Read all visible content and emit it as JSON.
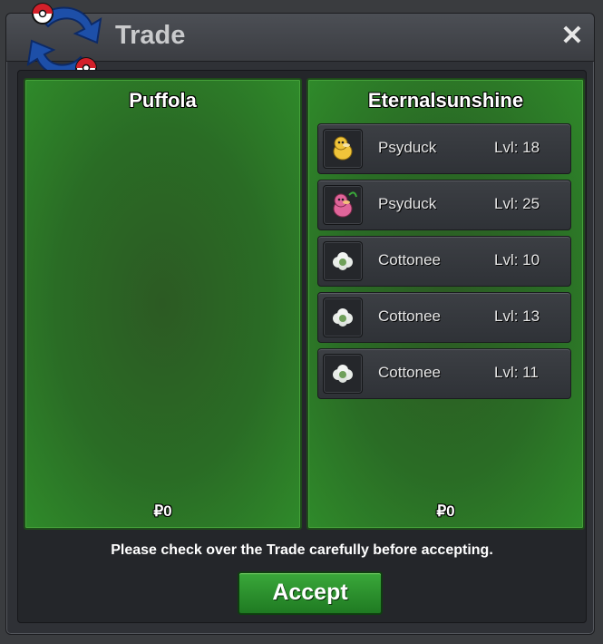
{
  "window": {
    "title": "Trade"
  },
  "left_panel": {
    "trainer": "Puffola",
    "money": "₽0"
  },
  "right_panel": {
    "trainer": "Eternalsunshine",
    "money": "₽0",
    "pokemon": [
      {
        "name": "Psyduck",
        "level": "Lvl: 18",
        "sprite_icon": "psyduck-icon"
      },
      {
        "name": "Psyduck",
        "level": "Lvl: 25",
        "sprite_icon": "psyduck-shiny-icon"
      },
      {
        "name": "Cottonee",
        "level": "Lvl: 10",
        "sprite_icon": "cottonee-icon"
      },
      {
        "name": "Cottonee",
        "level": "Lvl: 13",
        "sprite_icon": "cottonee-icon"
      },
      {
        "name": "Cottonee",
        "level": "Lvl: 11",
        "sprite_icon": "cottonee-icon"
      }
    ]
  },
  "notice": "Please check over the Trade carefully before accepting.",
  "accept_label": "Accept",
  "close_glyph": "✕",
  "colors": {
    "panel_green": "#2a6c25",
    "button_green": "#2a8f2c",
    "window_bg": "#2f3136"
  }
}
